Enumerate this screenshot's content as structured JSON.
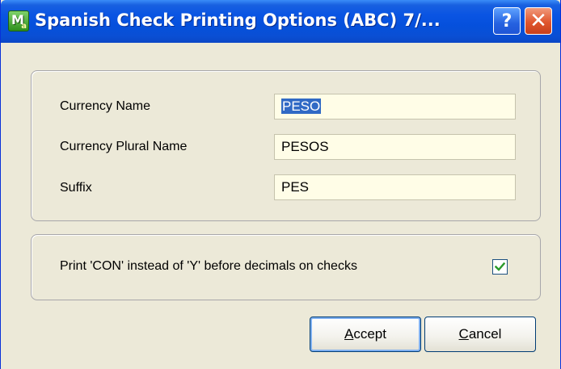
{
  "window": {
    "title": "Spanish Check Printing Options (ABC) 7/...",
    "icon": "m-app-icon",
    "help_glyph": "?",
    "close_glyph": "✕"
  },
  "form": {
    "currency_name_label": "Currency Name",
    "currency_name_value": "PESO",
    "currency_plural_label": "Currency Plural Name",
    "currency_plural_value": "PESOS",
    "suffix_label": "Suffix",
    "suffix_value": "PES"
  },
  "option": {
    "print_con_label": "Print 'CON' instead of 'Y' before decimals on checks",
    "print_con_checked": true
  },
  "buttons": {
    "accept_mnemonic": "A",
    "accept_rest": "ccept",
    "cancel_mnemonic": "C",
    "cancel_rest": "ancel"
  },
  "colors": {
    "titlebar": "#0a54e3",
    "dialog_bg": "#ece9d8",
    "field_bg": "#fffde7",
    "selection": "#316ac5",
    "check": "#2a9a2a"
  }
}
